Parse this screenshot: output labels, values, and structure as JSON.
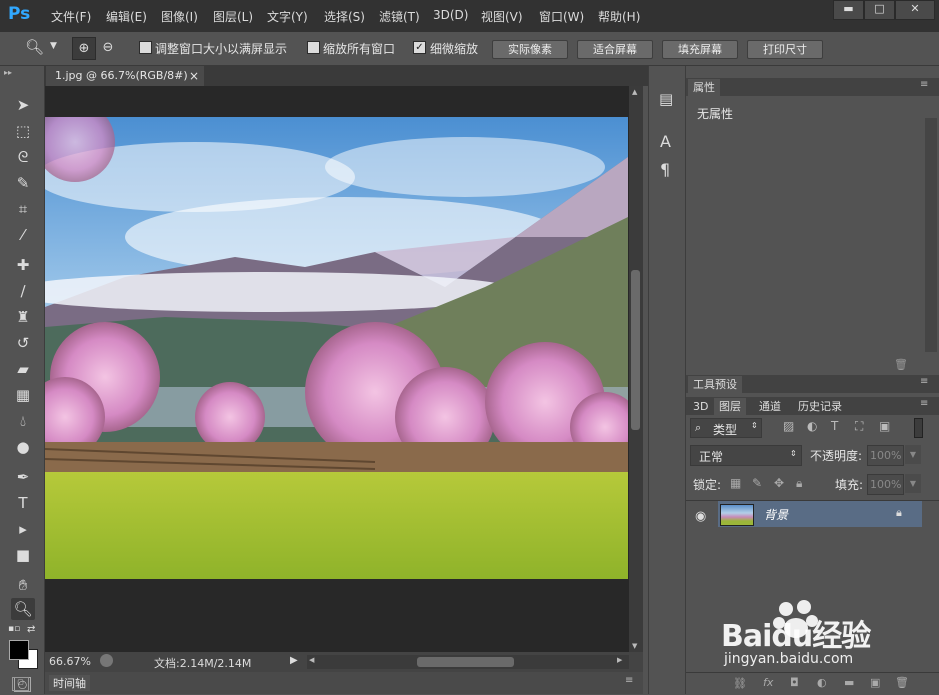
{
  "app": {
    "logo": "Ps"
  },
  "menu": [
    "文件(F)",
    "编辑(E)",
    "图像(I)",
    "图层(L)",
    "文字(Y)",
    "选择(S)",
    "滤镜(T)",
    "3D(D)",
    "视图(V)",
    "窗口(W)",
    "帮助(H)"
  ],
  "options": {
    "resize_windows": "调整窗口大小以满屏显示",
    "zoom_all_windows": "缩放所有窗口",
    "scrubby_zoom": "细微缩放",
    "actual_pixels": "实际像素",
    "fit_screen": "适合屏幕",
    "fill_screen": "填充屏幕",
    "print_size": "打印尺寸"
  },
  "document": {
    "tab_title": "1.jpg @ 66.7%(RGB/8#)",
    "close": "×"
  },
  "status": {
    "zoom": "66.67%",
    "doc_info": "文档:2.14M/2.14M"
  },
  "timeline_label": "时间轴",
  "properties": {
    "tab": "属性",
    "content": "无属性"
  },
  "tool_presets": {
    "tab": "工具预设"
  },
  "layers": {
    "tabs": [
      "3D",
      "图层",
      "通道",
      "历史记录"
    ],
    "filter_kind": "类型",
    "blend_mode": "正常",
    "opacity_label": "不透明度:",
    "opacity_value": "100%",
    "lock_label": "锁定:",
    "fill_label": "填充:",
    "fill_value": "100%",
    "layer_name": "背景"
  },
  "watermark": {
    "brand": "Baidu经验",
    "url": "jingyan.baidu.com"
  }
}
